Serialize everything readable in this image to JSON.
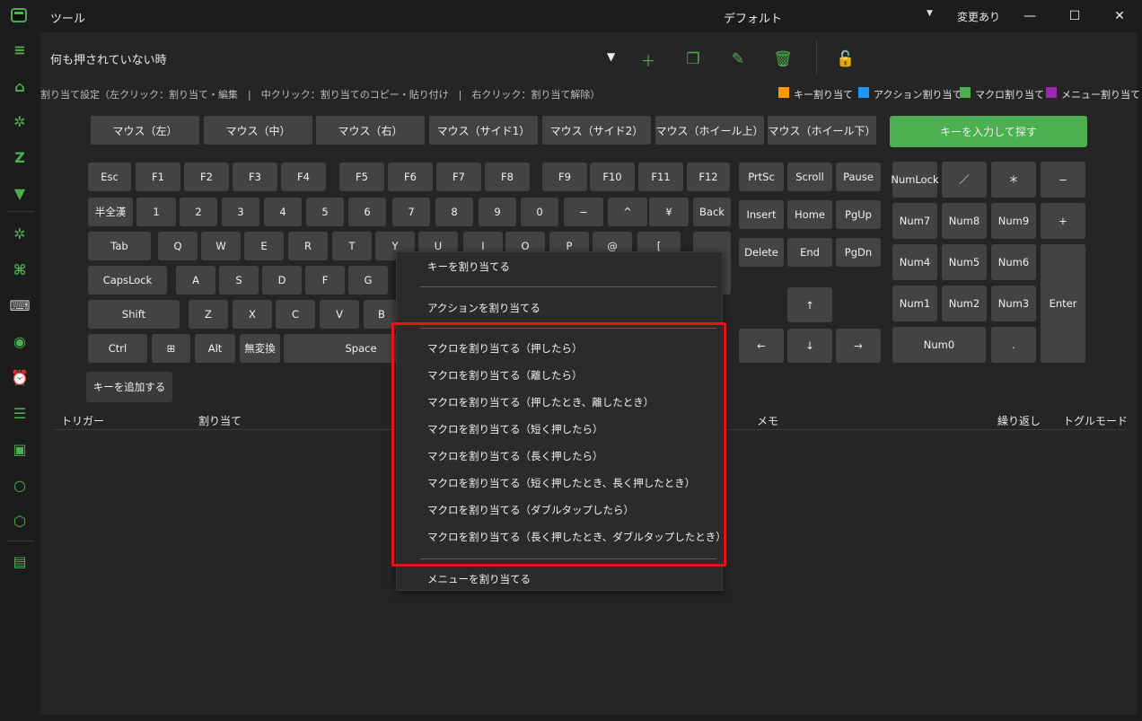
{
  "titlebar": {
    "app_title": "ツール",
    "profile_name": "デフォルト",
    "profile_arrow": "▼",
    "changed_label": "変更あり",
    "minimize": "—",
    "maximize": "☐",
    "close": "✕"
  },
  "condition": {
    "selected": "何も押されていない時",
    "arrow": "▼"
  },
  "help_text": "割り当て設定（左クリック：割り当て・編集　|　中クリック：割り当てのコピー・貼り付け　|　右クリック：割り当て解除）",
  "legend": [
    {
      "label": "キー割り当て",
      "color": "#ff9800"
    },
    {
      "label": "アクション割り当て",
      "color": "#2196f3"
    },
    {
      "label": "マクロ割り当て",
      "color": "#4caf50"
    },
    {
      "label": "メニュー割り当て",
      "color": "#9c27b0"
    }
  ],
  "mouse_buttons": [
    "マウス（左）",
    "マウス（中）",
    "マウス（右）",
    "マウス（サイド1）",
    "マウス（サイド2）",
    "マウス（ホイール上）",
    "マウス（ホイール下）"
  ],
  "search_key_button": "キーを入力して探す",
  "add_key_button": "キーを追加する",
  "keys": {
    "esc": "Esc",
    "f1": "F1",
    "f2": "F2",
    "f3": "F3",
    "f4": "F4",
    "f5": "F5",
    "f6": "F6",
    "f7": "F7",
    "f8": "F8",
    "f9": "F9",
    "f10": "F10",
    "f11": "F11",
    "f12": "F12",
    "prtsc": "PrtSc",
    "scroll": "Scroll",
    "pause": "Pause",
    "hankaku": "半全漢",
    "k1": "1",
    "k2": "2",
    "k3": "3",
    "k4": "4",
    "k5": "5",
    "k6": "6",
    "k7": "7",
    "k8": "8",
    "k9": "9",
    "k0": "0",
    "minus": "−",
    "caret": "^",
    "yen": "¥",
    "back": "Back",
    "insert": "Insert",
    "home": "Home",
    "pgup": "PgUp",
    "tab": "Tab",
    "q": "Q",
    "w": "W",
    "e": "E",
    "r": "R",
    "t": "T",
    "y": "Y",
    "u": "U",
    "i": "I",
    "o": "O",
    "p": "P",
    "at": "@",
    "bracket": "[",
    "delete": "Delete",
    "end": "End",
    "pgdn": "PgDn",
    "capslock": "CapsLock",
    "a": "A",
    "s": "S",
    "d": "D",
    "f": "F",
    "g": "G",
    "shift": "Shift",
    "z": "Z",
    "x": "X",
    "c": "C",
    "v": "V",
    "b": "B",
    "ctrl": "Ctrl",
    "win": "⊞",
    "alt": "Alt",
    "muhenkan": "無変換",
    "space": "Space",
    "up": "↑",
    "left": "←",
    "down": "↓",
    "right": "→",
    "numlock": "NumLock",
    "slash": "／",
    "asterisk": "＊",
    "numminus": "−",
    "num7": "Num7",
    "num8": "Num8",
    "num9": "Num9",
    "plus": "+",
    "num4": "Num4",
    "num5": "Num5",
    "num6": "Num6",
    "num1": "Num1",
    "num2": "Num2",
    "num3": "Num3",
    "enter": "Enter",
    "num0": "Num0",
    "dot": "."
  },
  "table_headers": {
    "trigger": "トリガー",
    "assign": "割り当て",
    "memo": "メモ",
    "repeat": "繰り返し",
    "toggle": "トグルモード"
  },
  "context_menu": {
    "assign_key": "キーを割り当てる",
    "assign_action": "アクションを割り当てる",
    "macro_items": [
      "マクロを割り当てる（押したら）",
      "マクロを割り当てる（離したら）",
      "マクロを割り当てる（押したとき、離したとき）",
      "マクロを割り当てる（短く押したら）",
      "マクロを割り当てる（長く押したら）",
      "マクロを割り当てる（短く押したとき、長く押したとき）",
      "マクロを割り当てる（ダブルタップしたら）",
      "マクロを割り当てる（長く押したとき、ダブルタップしたとき）"
    ],
    "assign_menu": "メニューを割り当てる"
  },
  "colors": {
    "accent": "#4caf50",
    "highlight": "#e3151b",
    "key_bg": "#434343",
    "panel_bg": "#252525"
  }
}
